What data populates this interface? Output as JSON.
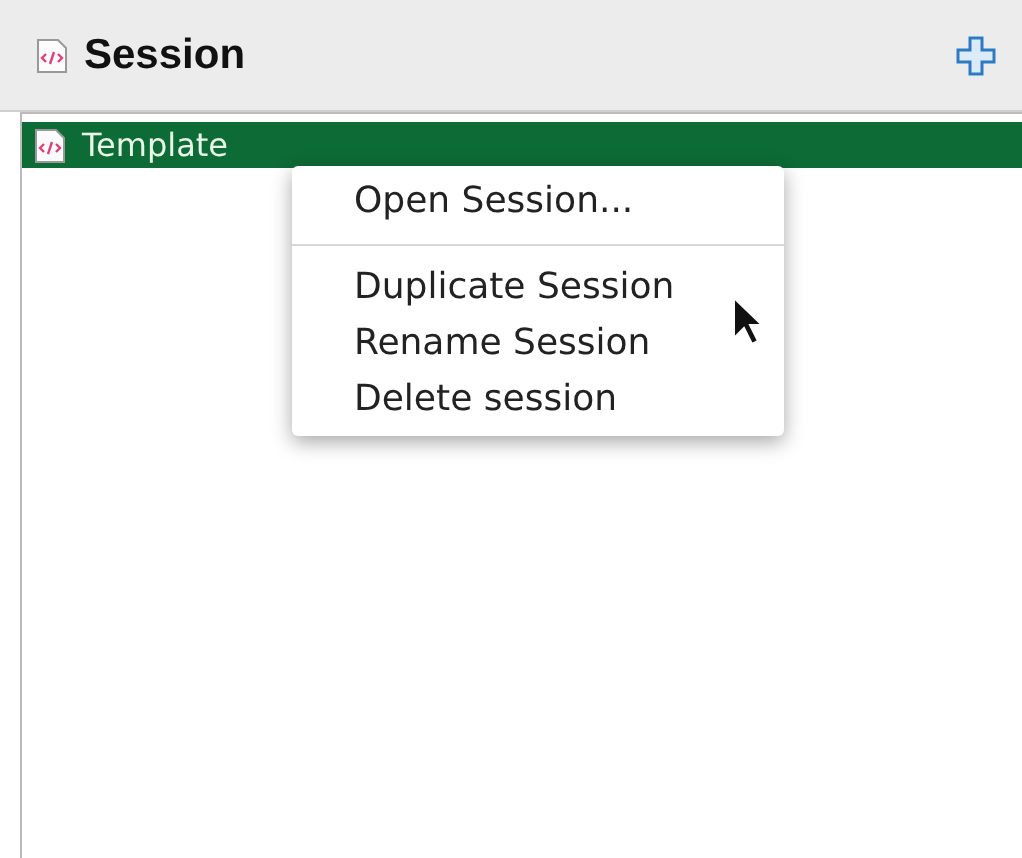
{
  "panel": {
    "title": "Session"
  },
  "sessions": [
    {
      "name": "Template",
      "selected": true
    }
  ],
  "context_menu": [
    {
      "kind": "item",
      "label": "Open Session..."
    },
    {
      "kind": "separator"
    },
    {
      "kind": "item",
      "label": "Duplicate Session"
    },
    {
      "kind": "item",
      "label": "Rename Session"
    },
    {
      "kind": "item",
      "label": "Delete session"
    }
  ]
}
